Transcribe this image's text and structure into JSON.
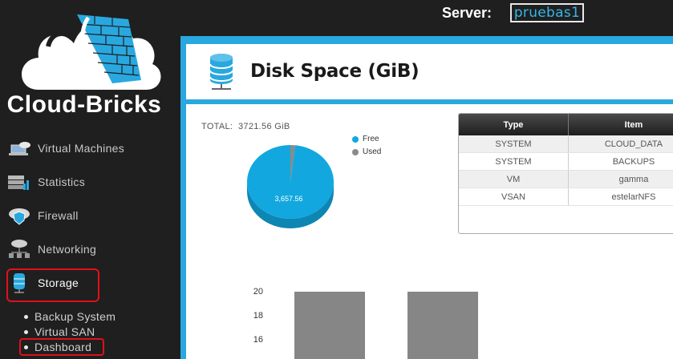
{
  "brand": {
    "name": "Cloud-Bricks"
  },
  "header": {
    "server_label": "Server:",
    "server_name": "pruebas1"
  },
  "sidebar": {
    "items": [
      {
        "label": "Virtual Machines",
        "icon": "laptop-cloud-icon"
      },
      {
        "label": "Statistics",
        "icon": "server-chart-icon"
      },
      {
        "label": "Firewall",
        "icon": "cloud-shield-icon"
      },
      {
        "label": "Networking",
        "icon": "network-icon"
      },
      {
        "label": "Storage",
        "icon": "database-icon",
        "active": true
      }
    ],
    "storage_sub": [
      {
        "label": "Backup System"
      },
      {
        "label": "Virtual SAN"
      },
      {
        "label": "Dashboard",
        "highlighted": true
      }
    ]
  },
  "panel": {
    "title": "Disk Space (GiB)",
    "total_label": "TOTAL:",
    "total_value": "3721.56 GiB"
  },
  "pie": {
    "legend": [
      {
        "label": "Free",
        "color": "#12a8df"
      },
      {
        "label": "Used",
        "color": "#8a8a8a"
      }
    ],
    "free_label": "3,657.56"
  },
  "table": {
    "headers": [
      "Type",
      "Item"
    ],
    "rows": [
      [
        "SYSTEM",
        "CLOUD_DATA"
      ],
      [
        "SYSTEM",
        "BACKUPS"
      ],
      [
        "VM",
        "gamma"
      ],
      [
        "VSAN",
        "estelarNFS"
      ]
    ]
  },
  "bars": {
    "ticks": [
      "20",
      "18",
      "16"
    ]
  },
  "chart_data": {
    "type": "pie",
    "title": "",
    "categories": [
      "Free",
      "Used"
    ],
    "values": [
      3657.56,
      64.0
    ]
  },
  "colors": {
    "accent": "#29a8e0",
    "highlight": "#e0101a",
    "sidebar_bg": "#1f1f1f"
  }
}
